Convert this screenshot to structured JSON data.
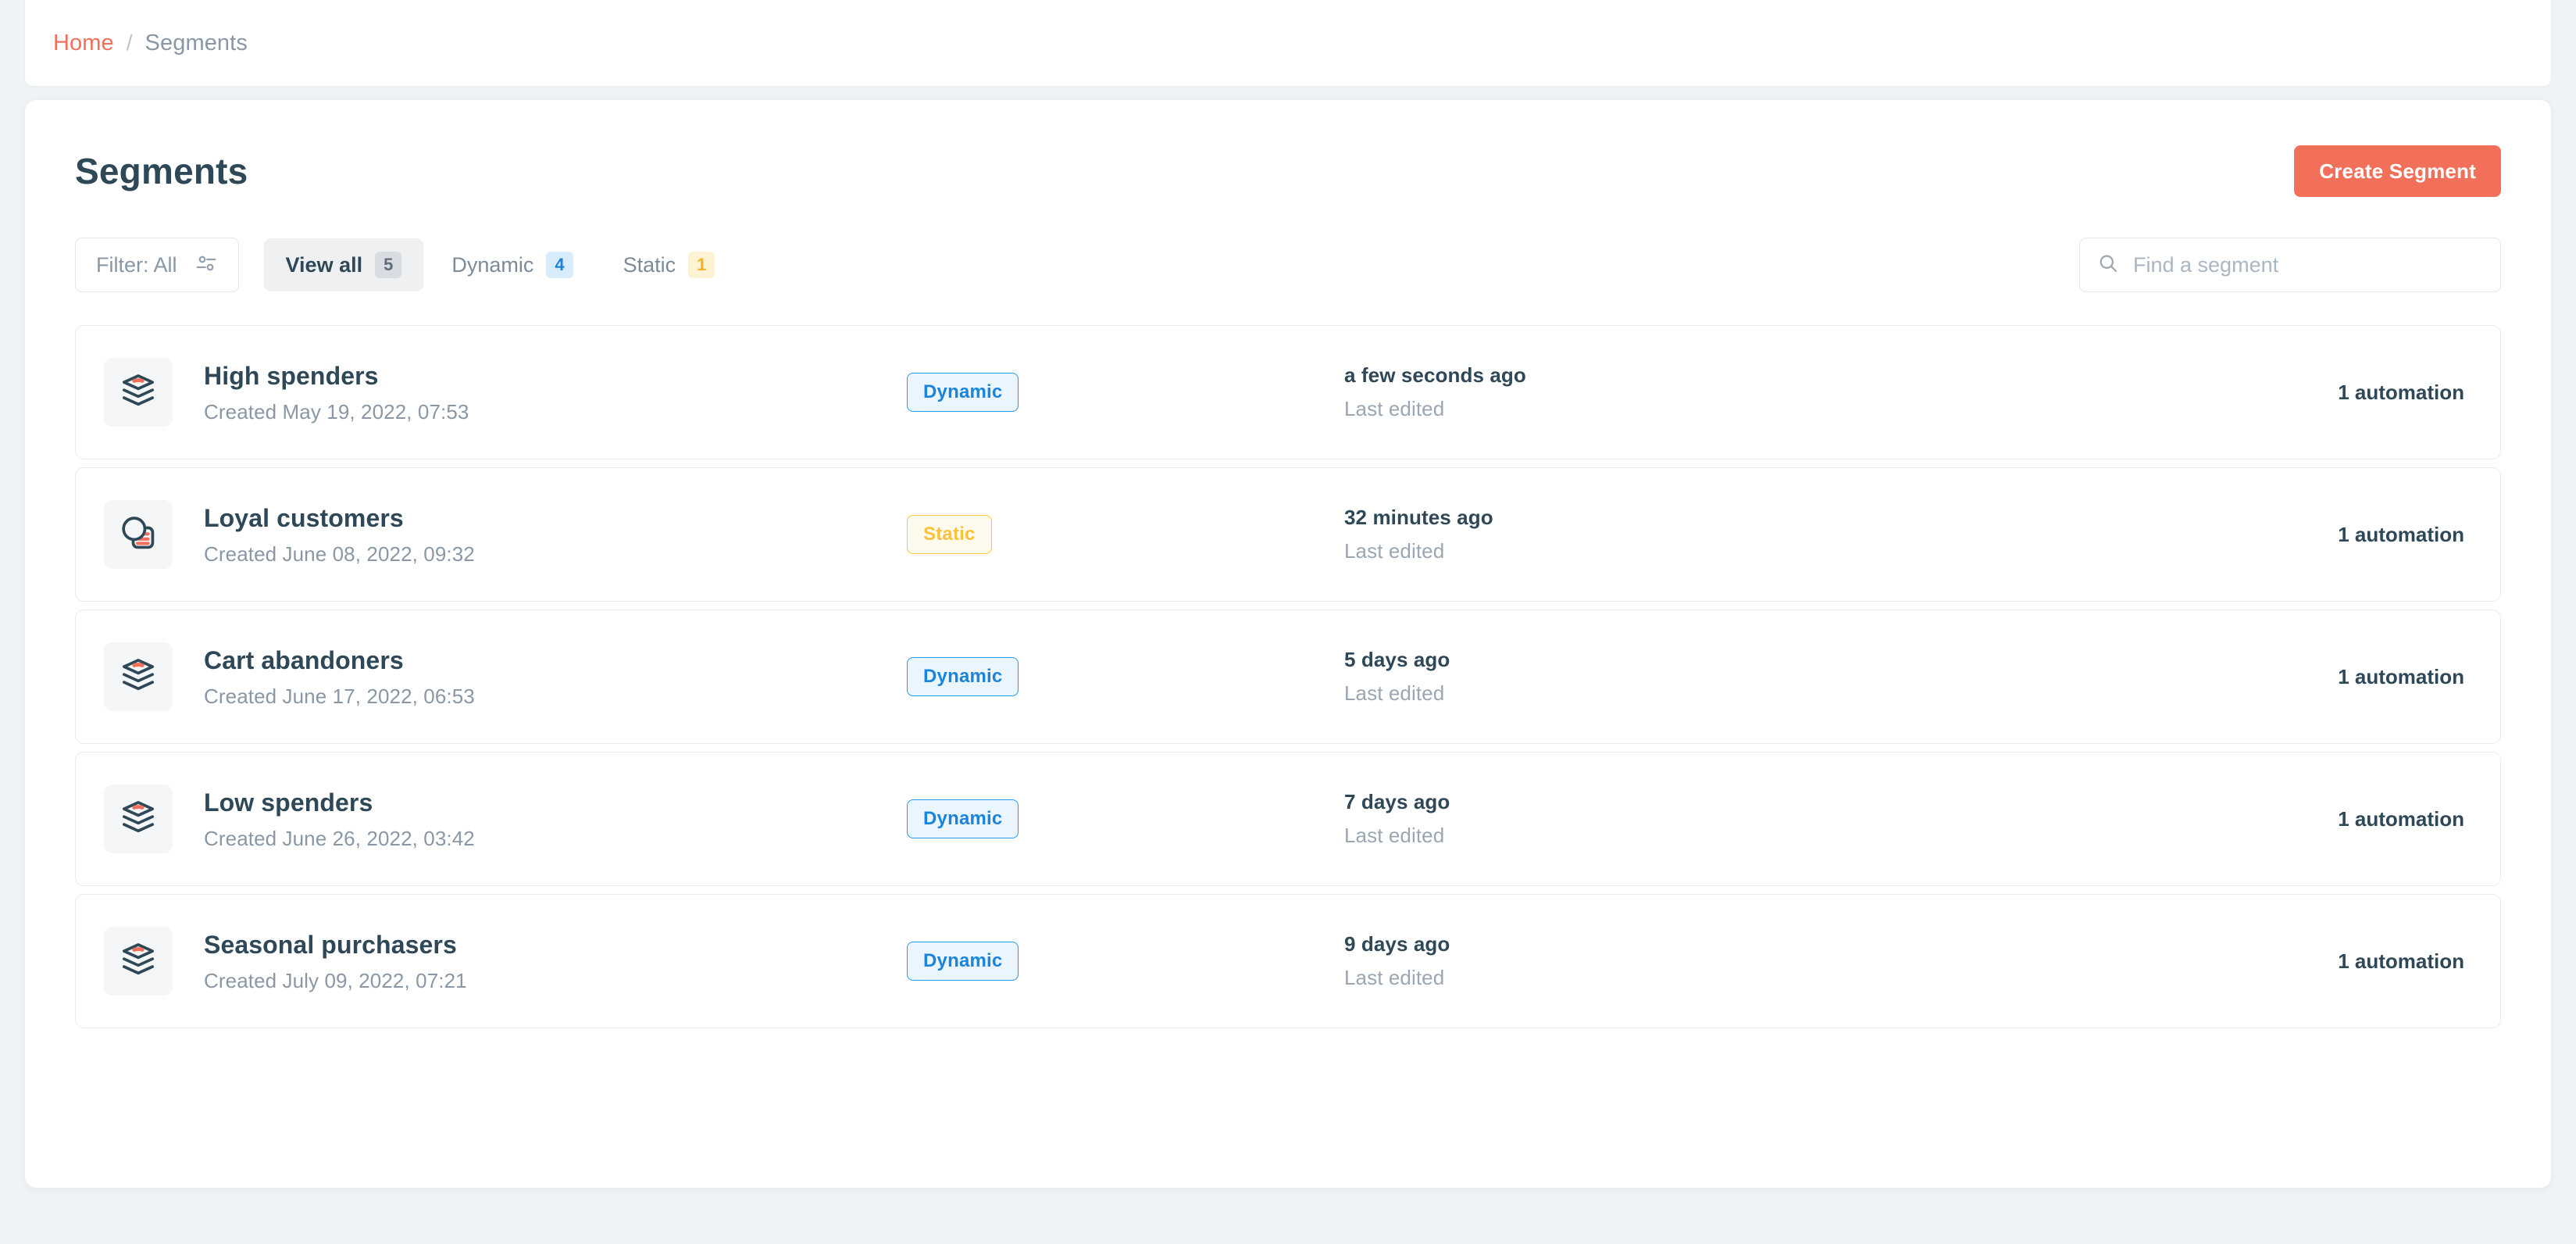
{
  "breadcrumb": {
    "home": "Home",
    "separator": "/",
    "current": "Segments"
  },
  "header": {
    "title": "Segments",
    "create_button": "Create Segment"
  },
  "toolbar": {
    "filter_label": "Filter: All",
    "tabs": [
      {
        "label": "View all",
        "count": "5",
        "count_style": "neutral",
        "active": true
      },
      {
        "label": "Dynamic",
        "count": "4",
        "count_style": "blue",
        "active": false
      },
      {
        "label": "Static",
        "count": "1",
        "count_style": "amber",
        "active": false
      }
    ],
    "search_placeholder": "Find a segment",
    "search_value": ""
  },
  "colors": {
    "accent": "#f2705a",
    "title": "#2f4858",
    "muted": "#8a97a5",
    "dynamic": "#1a85db",
    "static": "#f8c23b",
    "page_bg": "#eff3f6"
  },
  "segments": [
    {
      "icon": "layers-icon",
      "name": "High spenders",
      "created": "Created May 19, 2022, 07:53",
      "type": "Dynamic",
      "type_style": "dynamic",
      "last_edited_value": "a few seconds ago",
      "last_edited_label": "Last edited",
      "automations": "1 automation"
    },
    {
      "icon": "static-list-icon",
      "name": "Loyal customers",
      "created": "Created June 08, 2022, 09:32",
      "type": "Static",
      "type_style": "static",
      "last_edited_value": "32 minutes ago",
      "last_edited_label": "Last edited",
      "automations": "1 automation"
    },
    {
      "icon": "layers-icon",
      "name": "Cart abandoners",
      "created": "Created June 17, 2022, 06:53",
      "type": "Dynamic",
      "type_style": "dynamic",
      "last_edited_value": "5 days ago",
      "last_edited_label": "Last edited",
      "automations": "1 automation"
    },
    {
      "icon": "layers-icon",
      "name": "Low spenders",
      "created": "Created June 26, 2022, 03:42",
      "type": "Dynamic",
      "type_style": "dynamic",
      "last_edited_value": "7 days ago",
      "last_edited_label": "Last edited",
      "automations": "1 automation"
    },
    {
      "icon": "layers-icon",
      "name": "Seasonal purchasers",
      "created": "Created July 09, 2022, 07:21",
      "type": "Dynamic",
      "type_style": "dynamic",
      "last_edited_value": "9 days ago",
      "last_edited_label": "Last edited",
      "automations": "1 automation"
    }
  ]
}
